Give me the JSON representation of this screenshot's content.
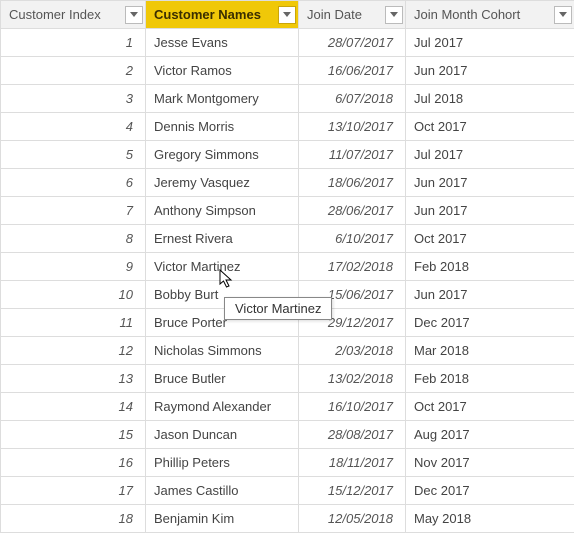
{
  "columns": {
    "index": "Customer Index",
    "names": "Customer Names",
    "joinDate": "Join Date",
    "cohort": "Join Month Cohort"
  },
  "tooltip": "Victor Martinez",
  "rows": [
    {
      "idx": "1",
      "name": "Jesse Evans",
      "date": "28/07/2017",
      "cohort": "Jul 2017"
    },
    {
      "idx": "2",
      "name": "Victor Ramos",
      "date": "16/06/2017",
      "cohort": "Jun 2017"
    },
    {
      "idx": "3",
      "name": "Mark Montgomery",
      "date": "6/07/2018",
      "cohort": "Jul 2018"
    },
    {
      "idx": "4",
      "name": "Dennis Morris",
      "date": "13/10/2017",
      "cohort": "Oct 2017"
    },
    {
      "idx": "5",
      "name": "Gregory Simmons",
      "date": "11/07/2017",
      "cohort": "Jul 2017"
    },
    {
      "idx": "6",
      "name": "Jeremy Vasquez",
      "date": "18/06/2017",
      "cohort": "Jun 2017"
    },
    {
      "idx": "7",
      "name": "Anthony Simpson",
      "date": "28/06/2017",
      "cohort": "Jun 2017"
    },
    {
      "idx": "8",
      "name": "Ernest Rivera",
      "date": "6/10/2017",
      "cohort": "Oct 2017"
    },
    {
      "idx": "9",
      "name": "Victor Martinez",
      "date": "17/02/2018",
      "cohort": "Feb 2018"
    },
    {
      "idx": "10",
      "name": "Bobby Burt",
      "date": "15/06/2017",
      "cohort": "Jun 2017"
    },
    {
      "idx": "11",
      "name": "Bruce Porter",
      "date": "29/12/2017",
      "cohort": "Dec 2017"
    },
    {
      "idx": "12",
      "name": "Nicholas Simmons",
      "date": "2/03/2018",
      "cohort": "Mar 2018"
    },
    {
      "idx": "13",
      "name": "Bruce Butler",
      "date": "13/02/2018",
      "cohort": "Feb 2018"
    },
    {
      "idx": "14",
      "name": "Raymond Alexander",
      "date": "16/10/2017",
      "cohort": "Oct 2017"
    },
    {
      "idx": "15",
      "name": "Jason Duncan",
      "date": "28/08/2017",
      "cohort": "Aug 2017"
    },
    {
      "idx": "16",
      "name": "Phillip Peters",
      "date": "18/11/2017",
      "cohort": "Nov 2017"
    },
    {
      "idx": "17",
      "name": "James Castillo",
      "date": "15/12/2017",
      "cohort": "Dec 2017"
    },
    {
      "idx": "18",
      "name": "Benjamin Kim",
      "date": "12/05/2018",
      "cohort": "May 2018"
    }
  ]
}
